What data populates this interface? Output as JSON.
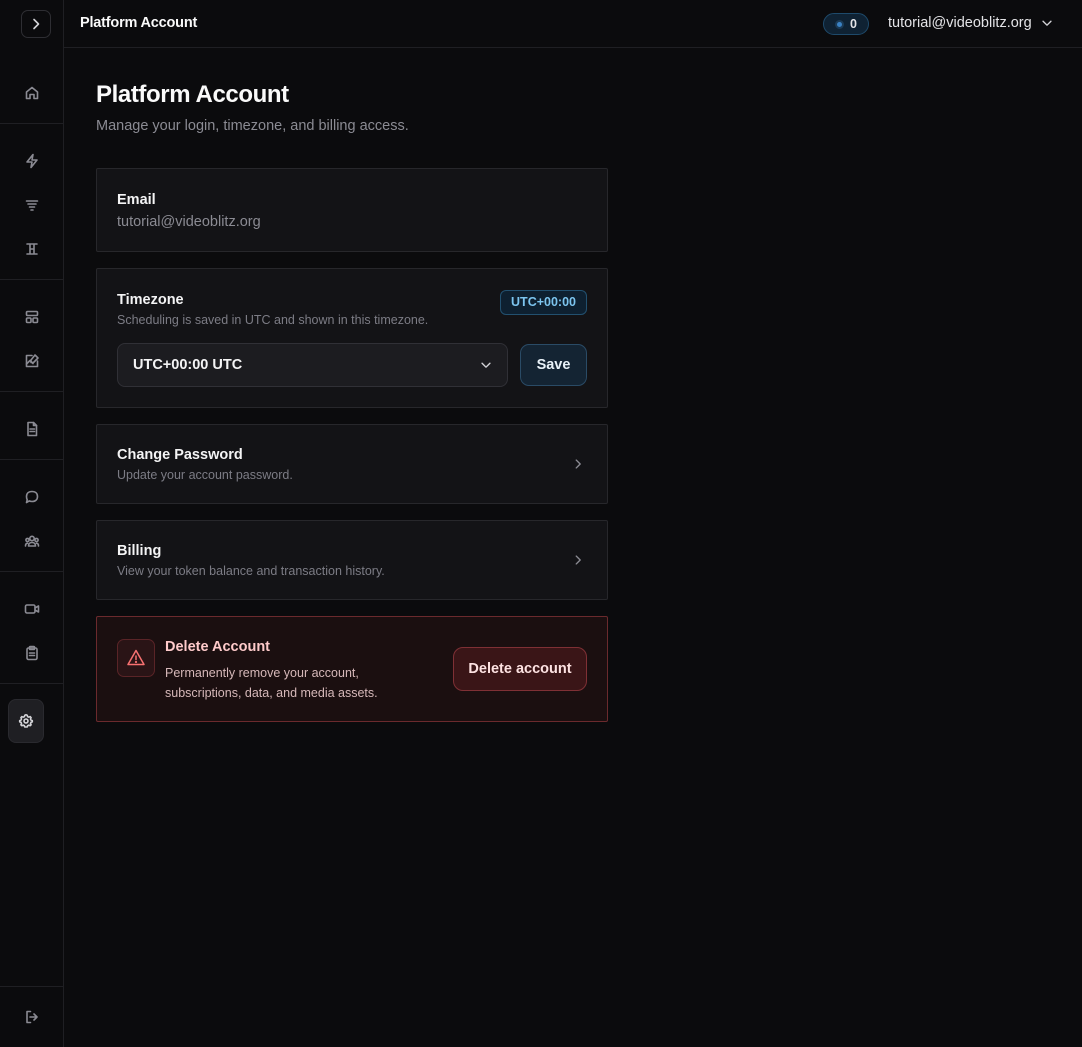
{
  "topbar": {
    "title": "Platform Account",
    "token_count": "0",
    "user_email": "tutorial@videoblitz.org"
  },
  "sidebar": {
    "items": [
      {
        "icon": "home-icon"
      },
      {
        "icon": "lightning-icon"
      },
      {
        "icon": "filter-lines-icon"
      },
      {
        "icon": "text-height-icon"
      },
      {
        "icon": "layout-icon"
      },
      {
        "icon": "image-edit-icon"
      },
      {
        "icon": "document-icon"
      },
      {
        "icon": "chat-bubble-icon"
      },
      {
        "icon": "users-icon"
      },
      {
        "icon": "video-camera-icon"
      },
      {
        "icon": "clipboard-icon"
      },
      {
        "icon": "settings-gear-icon",
        "active": true
      },
      {
        "icon": "logout-icon"
      }
    ]
  },
  "page": {
    "title": "Platform Account",
    "subtitle": "Manage your login, timezone, and billing access."
  },
  "email_card": {
    "title": "Email",
    "value": "tutorial@videoblitz.org"
  },
  "timezone_card": {
    "title": "Timezone",
    "description": "Scheduling is saved in UTC and shown in this timezone.",
    "badge": "UTC+00:00",
    "selected": "UTC+00:00 UTC",
    "save_label": "Save"
  },
  "password_card": {
    "title": "Change Password",
    "description": "Update your account password."
  },
  "billing_card": {
    "title": "Billing",
    "description": "View your token balance and transaction history."
  },
  "danger_card": {
    "title": "Delete Account",
    "description": "Permanently remove your account, subscriptions, data, and media assets.",
    "button_label": "Delete account"
  },
  "colors": {
    "background": "#0b0b0d",
    "card": "#131316",
    "accent": "#7cc4ee",
    "danger": "#fecaca"
  }
}
